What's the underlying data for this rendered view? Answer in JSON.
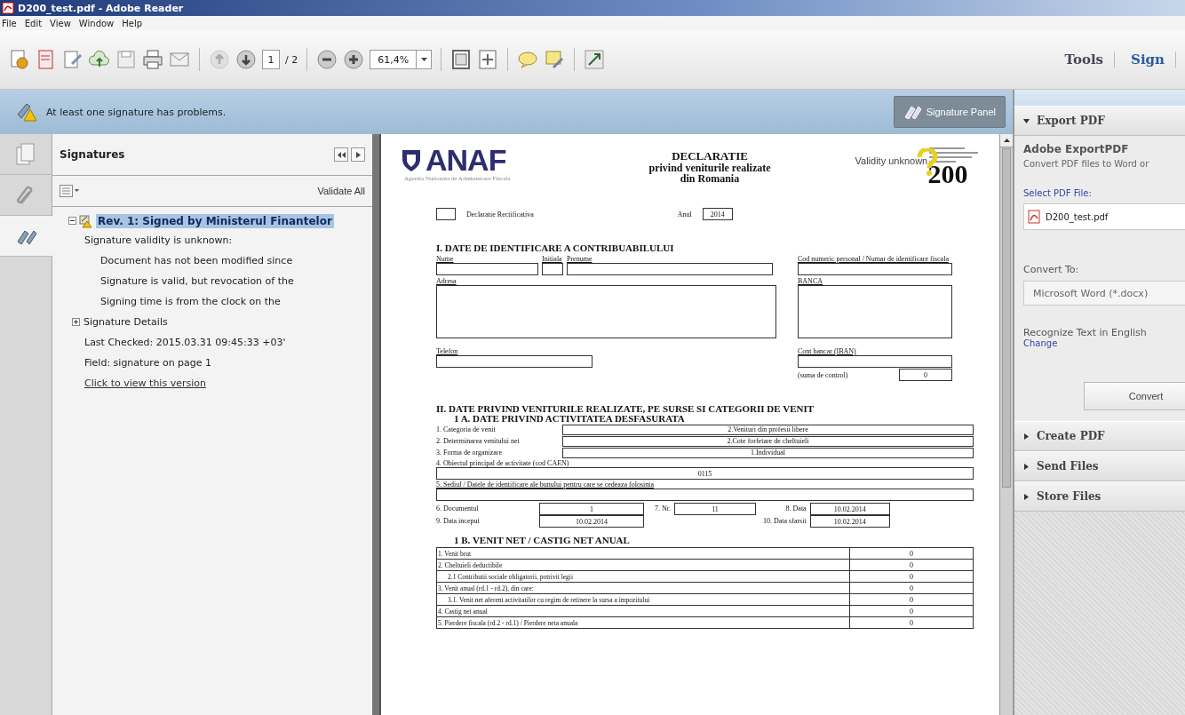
{
  "window": {
    "title": "D200_test.pdf - Adobe Reader"
  },
  "menu": [
    "File",
    "Edit",
    "View",
    "Window",
    "Help"
  ],
  "toolbar": {
    "previous_page": {
      "disabled": true
    },
    "next_page": {
      "disabled": false
    },
    "page_number": "1",
    "page_total": "/ 2",
    "zoom": "61,4%",
    "right_buttons": [
      "Tools",
      "Sign"
    ]
  },
  "message_bar": {
    "text": "At least one signature has problems.",
    "button": "Signature Panel"
  },
  "side_tabs": [
    {
      "kind": "pages",
      "selected": false
    },
    {
      "kind": "attachments",
      "selected": false
    },
    {
      "kind": "signatures",
      "selected": true
    }
  ],
  "signatures_panel": {
    "title": "Signatures",
    "validate_all": "Validate All",
    "tree": [
      {
        "label": "Rev. 1: Signed by Ministerul Finantelor",
        "selected": true,
        "expanded": true,
        "children": [
          {
            "kind": "text",
            "label": "Signature validity is unknown:",
            "children": [
              {
                "kind": "text",
                "label": "Document has not been modified since"
              },
              {
                "kind": "text",
                "label": "Signature is valid, but revocation of the"
              },
              {
                "kind": "text",
                "label": "Signing time is from the clock on the"
              }
            ]
          },
          {
            "kind": "toggle",
            "label": "Signature Details",
            "expanded": false
          },
          {
            "kind": "text",
            "label": "Last Checked: 2015.03.31 09:45:33 +03'"
          },
          {
            "kind": "text",
            "label": "Field: signature on page 1"
          },
          {
            "kind": "link",
            "label": "Click to view this version"
          }
        ]
      }
    ]
  },
  "document": {
    "logo": "ANAF",
    "agency": "Agentia Nationala de Administrare Fiscala",
    "title_lines": [
      "DECLARATIE",
      "privind veniturile realizate",
      "din Romania"
    ],
    "signature_status": "Validity unknown",
    "form_number": "200",
    "rectificativa": {
      "label": "Declaratie Rectificativa",
      "checked": false
    },
    "year_label": "Anul",
    "year": "2014",
    "section1": {
      "title": "I. DATE DE IDENTIFICARE A CONTRIBUABILULUI",
      "name_label": "Nume",
      "initial_label": "Initiala",
      "surname_label": "Prenume",
      "cnp_label": "Cod numeric personal / Numar de identificare fiscala",
      "address_label": "Adresa",
      "bank_label": "BANCA",
      "phone_label": "Telefon",
      "iban_label": "Cont bancar (IBAN)",
      "checksum_label": "(suma de control)",
      "checksum": "0"
    },
    "section2": {
      "title": "II. DATE PRIVIND VENITURILE REALIZATE, PE SURSE SI CATEGORII DE VENIT",
      "subtitle": "1 A. DATE PRIVIND ACTIVITATEA DESFASURATA",
      "rows": [
        {
          "label": "1. Categoria de venit",
          "value": "2.Venituri din profesii libere"
        },
        {
          "label": "2. Determinarea venitului net",
          "value": "2.Cote forfetare de cheltuieli"
        },
        {
          "label": "3. Forma de organizare",
          "value": "1.Individual"
        }
      ],
      "activity_label": "4. Obiectul principal de activitate (cod CAEN)",
      "activity": "0115",
      "location_label": "5. Sediul / Datele de identificare ale bunului pentru care se cedeaza folosinta",
      "document_label": "6. Documentul",
      "document_value": "1",
      "number_label": "7. Nr.",
      "number_value": "11",
      "date_label": "8. Data",
      "date_value": "10.02.2014",
      "start_label": "9. Data inceput",
      "start_value": "10.02.2014",
      "end_label": "10. Data sfarsit",
      "end_value": "10.02.2014"
    },
    "section1b": {
      "title": "1 B. VENIT NET / CASTIG NET ANUAL",
      "rows": [
        {
          "kind": "row",
          "label": "1. Venit brut",
          "value": "0"
        },
        {
          "kind": "row",
          "label": "2. Cheltuieli deductibile",
          "value": "0"
        },
        {
          "kind": "subrow",
          "label": "2.1 Contributii sociale obligatorii, potrivit legii",
          "value": "0"
        },
        {
          "kind": "row",
          "label": "3. Venit anual (rd.1 - rd.2), din care:",
          "value": "0"
        },
        {
          "kind": "subrow",
          "label": "3.1. Venit net aferent activitatilor cu regim de retinere la sursa a impozitului",
          "value": "0"
        },
        {
          "kind": "row",
          "label": "4. Castig net anual",
          "value": "0"
        },
        {
          "kind": "row",
          "label": "5. Pierdere fiscala (rd.2 - rd.1) / Pierdere neta anuala",
          "value": "0"
        }
      ]
    }
  },
  "right_panel": {
    "sections": [
      {
        "title": "Export PDF",
        "expanded": true,
        "content": {
          "heading": "Adobe ExportPDF",
          "description": "Convert PDF files to Word or",
          "select_label": "Select PDF File:",
          "file": "D200_test.pdf",
          "convert_to_label": "Convert To:",
          "format": "Microsoft Word (*.docx)",
          "recognize": "Recognize Text in English",
          "change_link": "Change",
          "convert_button": "Convert"
        }
      },
      {
        "title": "Create PDF",
        "expanded": false
      },
      {
        "title": "Send Files",
        "expanded": false
      },
      {
        "title": "Store Files",
        "expanded": false
      }
    ]
  }
}
